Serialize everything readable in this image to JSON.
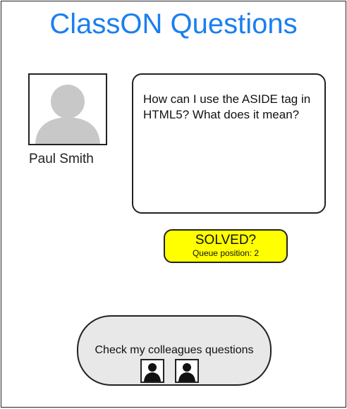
{
  "header": {
    "title": "ClassON Questions"
  },
  "user": {
    "name": "Paul Smith",
    "avatar_icon": "person-silhouette-icon"
  },
  "question": {
    "text": "How can I use the ASIDE tag in HTML5? What does it mean?"
  },
  "status": {
    "solved_label": "SOLVED?",
    "queue_label": "Queue position: 2",
    "color": "#ffff00"
  },
  "colleagues": {
    "button_label": "Check my colleagues questions",
    "icons": [
      "person-icon",
      "person-icon"
    ]
  },
  "colors": {
    "title": "#1a7ff0",
    "button_background": "#e8e8e8"
  }
}
